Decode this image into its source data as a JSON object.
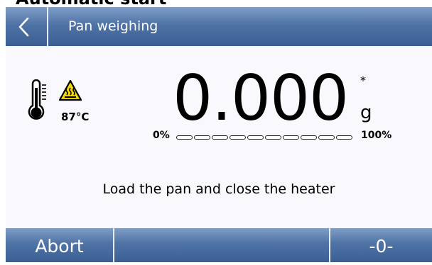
{
  "window": {
    "heading": "Automatic start"
  },
  "header": {
    "title": "Pan weighing",
    "back_icon": "chevron-left-icon"
  },
  "status": {
    "temperature": "87°C",
    "thermometer_icon": "thermometer-icon",
    "warning_icon": "hot-surface-warning-icon"
  },
  "display": {
    "weight": "0.000",
    "stability_marker": "*",
    "unit": "g"
  },
  "load_bar": {
    "min_label": "0%",
    "max_label": "100%",
    "segments": 10,
    "fill_fraction": 0
  },
  "message": "Load the pan and close the heater",
  "footer": {
    "abort_label": "Abort",
    "middle_label": "",
    "zero_label": "-0-"
  },
  "colors": {
    "bar_top": "#7f9ec6",
    "bar_bottom": "#3a5f93",
    "warning_yellow": "#f5d800"
  }
}
